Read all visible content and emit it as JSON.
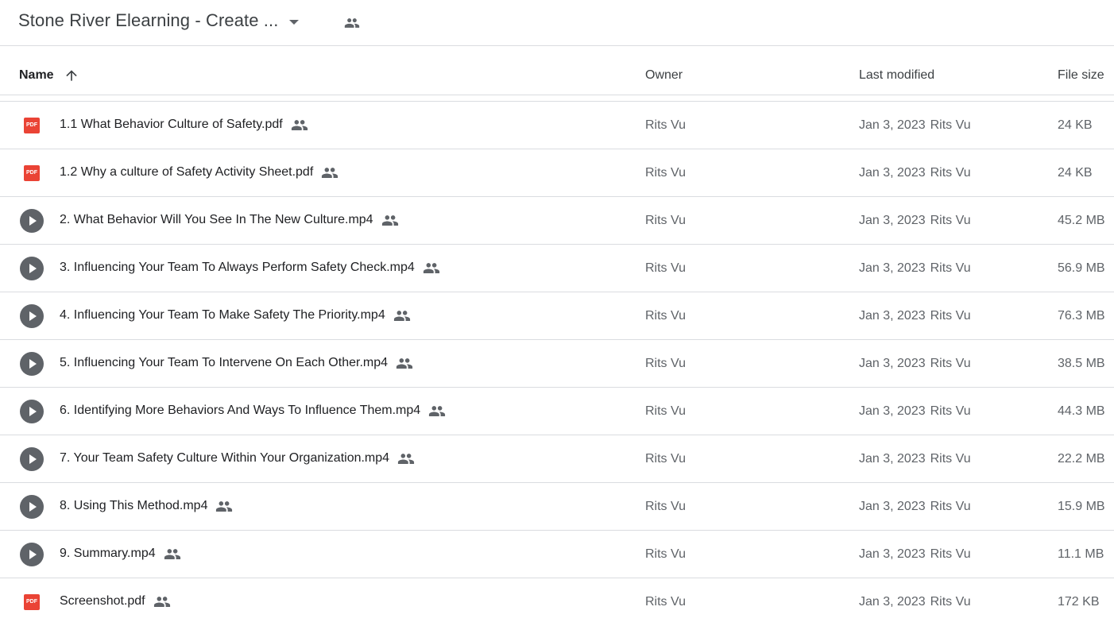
{
  "folder": {
    "title": "Stone River Elearning - Create ..."
  },
  "columns": {
    "name": "Name",
    "owner": "Owner",
    "last_modified": "Last modified",
    "file_size": "File size"
  },
  "files": [
    {
      "type": "pdf",
      "name": "1.1 What Behavior Culture of Safety.pdf",
      "owner": "Rits Vu",
      "modified_date": "Jan 3, 2023",
      "modified_by": "Rits Vu",
      "size": "24 KB"
    },
    {
      "type": "pdf",
      "name": "1.2 Why a culture of Safety Activity Sheet.pdf",
      "owner": "Rits Vu",
      "modified_date": "Jan 3, 2023",
      "modified_by": "Rits Vu",
      "size": "24 KB"
    },
    {
      "type": "video",
      "name": "2. What Behavior Will You See In The New Culture.mp4",
      "owner": "Rits Vu",
      "modified_date": "Jan 3, 2023",
      "modified_by": "Rits Vu",
      "size": "45.2 MB"
    },
    {
      "type": "video",
      "name": "3. Influencing Your Team To Always Perform Safety Check.mp4",
      "owner": "Rits Vu",
      "modified_date": "Jan 3, 2023",
      "modified_by": "Rits Vu",
      "size": "56.9 MB"
    },
    {
      "type": "video",
      "name": "4. Influencing Your Team To Make Safety The Priority.mp4",
      "owner": "Rits Vu",
      "modified_date": "Jan 3, 2023",
      "modified_by": "Rits Vu",
      "size": "76.3 MB"
    },
    {
      "type": "video",
      "name": "5. Influencing Your Team To Intervene On Each Other.mp4",
      "owner": "Rits Vu",
      "modified_date": "Jan 3, 2023",
      "modified_by": "Rits Vu",
      "size": "38.5 MB"
    },
    {
      "type": "video",
      "name": "6. Identifying More Behaviors And Ways To Influence Them.mp4",
      "owner": "Rits Vu",
      "modified_date": "Jan 3, 2023",
      "modified_by": "Rits Vu",
      "size": "44.3 MB"
    },
    {
      "type": "video",
      "name": "7. Your Team Safety Culture Within Your Organization.mp4",
      "owner": "Rits Vu",
      "modified_date": "Jan 3, 2023",
      "modified_by": "Rits Vu",
      "size": "22.2 MB"
    },
    {
      "type": "video",
      "name": "8. Using This Method.mp4",
      "owner": "Rits Vu",
      "modified_date": "Jan 3, 2023",
      "modified_by": "Rits Vu",
      "size": "15.9 MB"
    },
    {
      "type": "video",
      "name": "9. Summary.mp4",
      "owner": "Rits Vu",
      "modified_date": "Jan 3, 2023",
      "modified_by": "Rits Vu",
      "size": "11.1 MB"
    },
    {
      "type": "pdf",
      "name": "Screenshot.pdf",
      "owner": "Rits Vu",
      "modified_date": "Jan 3, 2023",
      "modified_by": "Rits Vu",
      "size": "172 KB"
    }
  ],
  "icons": {
    "pdf_label": "PDF",
    "shared": "shared-people-icon",
    "video": "play-circle-icon",
    "sort": "arrow-up-icon",
    "dropdown": "caret-down-icon"
  },
  "colors": {
    "pdf_red": "#ea4335",
    "icon_gray": "#5f6368",
    "divider": "#dadce0"
  }
}
